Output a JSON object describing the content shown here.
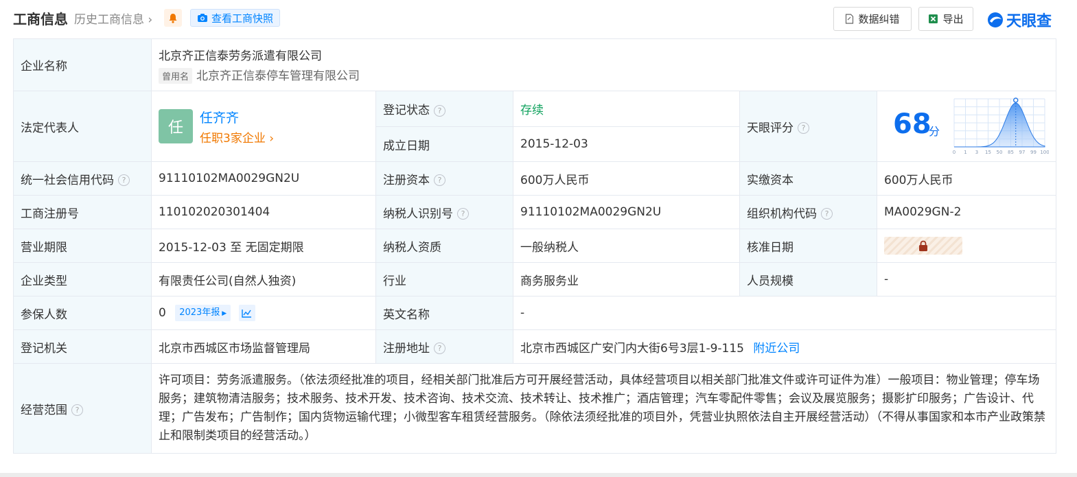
{
  "header": {
    "title": "工商信息",
    "history_link": "历史工商信息",
    "snapshot_button": "查看工商快照",
    "correction_button": "数据纠错",
    "export_button": "导出",
    "logo_text": "天眼查"
  },
  "company": {
    "name_label": "企业名称",
    "name": "北京齐正信泰劳务派遣有限公司",
    "former_tag": "曾用名",
    "former_name": "北京齐正信泰停车管理有限公司",
    "legal_rep_label": "法定代表人",
    "legal_rep_avatar": "任",
    "legal_rep_name": "任齐齐",
    "legal_rep_positions": "任职3家企业",
    "reg_status_label": "登记状态",
    "reg_status": "存续",
    "founded_label": "成立日期",
    "founded": "2015-12-03",
    "score_label": "天眼评分",
    "score_value": "68",
    "score_unit": "分",
    "credit_code_label": "统一社会信用代码",
    "credit_code": "91110102MA0029GN2U",
    "reg_capital_label": "注册资本",
    "reg_capital": "600万人民币",
    "paid_capital_label": "实缴资本",
    "paid_capital": "600万人民币",
    "reg_no_label": "工商注册号",
    "reg_no": "110102020301404",
    "taxpayer_id_label": "纳税人识别号",
    "taxpayer_id": "91110102MA0029GN2U",
    "org_code_label": "组织机构代码",
    "org_code": "MA0029GN-2",
    "term_label": "营业期限",
    "term": "2015-12-03 至 无固定期限",
    "taxpayer_type_label": "纳税人资质",
    "taxpayer_type": "一般纳税人",
    "approval_date_label": "核准日期",
    "company_type_label": "企业类型",
    "company_type": "有限责任公司(自然人独资)",
    "industry_label": "行业",
    "industry": "商务服务业",
    "staff_size_label": "人员规模",
    "staff_size": "-",
    "insured_label": "参保人数",
    "insured": "0",
    "insured_report": "2023年报",
    "english_name_label": "英文名称",
    "english_name": "-",
    "authority_label": "登记机关",
    "authority": "北京市西城区市场监督管理局",
    "address_label": "注册地址",
    "address": "北京市西城区广安门内大街6号3层1-9-115",
    "nearby_link": "附近公司",
    "scope_label": "经营范围",
    "scope": "许可项目：劳务派遣服务。（依法须经批准的项目，经相关部门批准后方可开展经营活动，具体经营项目以相关部门批准文件或许可证件为准）一般项目：物业管理；停车场服务；建筑物清洁服务；技术服务、技术开发、技术咨询、技术交流、技术转让、技术推广；酒店管理；汽车零配件零售；会议及展览服务；摄影扩印服务；广告设计、代理；广告发布；广告制作；国内货物运输代理；小微型客车租赁经营服务。（除依法须经批准的项目外，凭营业执照依法自主开展经营活动）（不得从事国家和本市产业政策禁止和限制类项目的经营活动。）"
  },
  "score_chart": {
    "ticks": [
      "0",
      "1",
      "3",
      "15",
      "50",
      "85",
      "97",
      "99",
      "100"
    ],
    "marker_value": 68
  },
  "colors": {
    "label_bg": "#f2f9fc",
    "link": "#0084ff",
    "status_green": "#12a35f",
    "accent_orange": "#f07800",
    "score_blue": "#0d6eed"
  },
  "icons": {
    "bell": "bell-icon",
    "camera": "camera-icon",
    "correction": "document-edit-icon",
    "excel": "excel-icon",
    "logo": "tianyancha-logo-icon",
    "help": "question-circle-icon",
    "lock": "lock-icon",
    "trend": "trend-chart-icon"
  }
}
